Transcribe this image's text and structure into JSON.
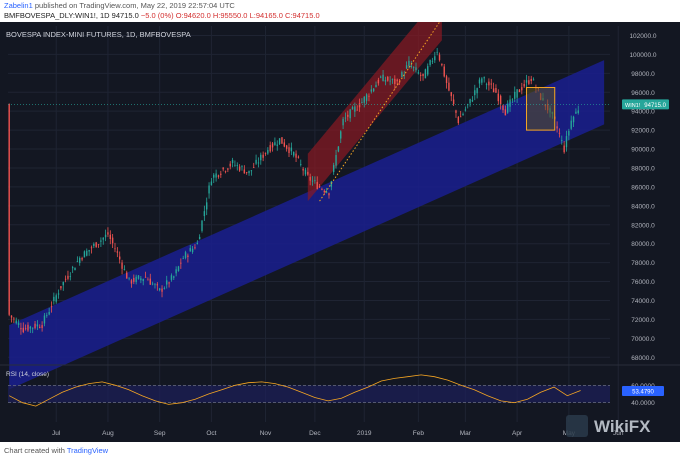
{
  "header": {
    "publisher_user": "Zabelin1",
    "publisher_text": " published on TradingView.com, May 22, 2019 22:57:04 UTC",
    "symbol_line_prefix": "BMFBOVESPA_DLY:WIN1!, 1D ",
    "last": "94715.0",
    "change": "−5.0 (0%)",
    "ohlc_o": "O:94620.0",
    "ohlc_h": "H:95550.0",
    "ohlc_l": "L:94165.0",
    "ohlc_c": "C:94715.0"
  },
  "footer": {
    "prefix": "Chart created with ",
    "brand": "TradingView"
  },
  "watermark": "WikiFX",
  "colors": {
    "background": "#131722",
    "grid": "#1f2433",
    "up_candle": "#26a69a",
    "down_candle": "#ef5350",
    "blue_channel": "#1a1f8f",
    "red_channel": "#8b1a22",
    "box_fill": "#5a5020",
    "box_stroke": "#f6a623",
    "rsi_line": "#f6a623",
    "price_tag": "#26a69a",
    "dotted_line": "#f6a623"
  },
  "chart_data": {
    "type": "candlestick",
    "title": "BOVESPA INDEX-MINI FUTURES, 1D, BMFBOVESPA",
    "price_axis_labels": [
      "102000.0",
      "100000.0",
      "98000.0",
      "96000.0",
      "94000.0",
      "92000.0",
      "90000.0",
      "88000.0",
      "86000.0",
      "84000.0",
      "82000.0",
      "80000.0",
      "78000.0",
      "76000.0",
      "74000.0",
      "72000.0",
      "70000.0",
      "68000.0"
    ],
    "ylim": [
      67500,
      103000
    ],
    "x_labels": [
      "Jul",
      "Aug",
      "Sep",
      "Oct",
      "Nov",
      "Dec",
      "2019",
      "Feb",
      "Mar",
      "Apr",
      "May",
      "Jun"
    ],
    "current_price_tag": {
      "symbol": "WIN1!",
      "value": "94715.0"
    },
    "close_path": [
      [
        0,
        72500
      ],
      [
        6,
        71000
      ],
      [
        14,
        71500
      ],
      [
        22,
        75500
      ],
      [
        30,
        78500
      ],
      [
        37,
        80000
      ],
      [
        42,
        81000
      ],
      [
        45,
        79500
      ],
      [
        51,
        76000
      ],
      [
        58,
        76500
      ],
      [
        64,
        75000
      ],
      [
        70,
        76500
      ],
      [
        74,
        78500
      ],
      [
        80,
        80000
      ],
      [
        86,
        87000
      ],
      [
        95,
        88500
      ],
      [
        102,
        87500
      ],
      [
        110,
        90000
      ],
      [
        115,
        91000
      ],
      [
        121,
        89500
      ],
      [
        127,
        87000
      ],
      [
        132,
        86000
      ],
      [
        136,
        85500
      ],
      [
        142,
        93000
      ],
      [
        150,
        95000
      ],
      [
        158,
        97500
      ],
      [
        165,
        97000
      ],
      [
        170,
        99000
      ],
      [
        176,
        97500
      ],
      [
        182,
        100500
      ],
      [
        186,
        97000
      ],
      [
        191,
        93000
      ],
      [
        196,
        95000
      ],
      [
        201,
        97500
      ],
      [
        207,
        96000
      ],
      [
        211,
        94000
      ],
      [
        216,
        96000
      ],
      [
        222,
        97500
      ],
      [
        226,
        95500
      ],
      [
        231,
        93500
      ],
      [
        234,
        91500
      ],
      [
        236,
        90000
      ],
      [
        239,
        93000
      ],
      [
        243,
        94715
      ]
    ],
    "rsi": {
      "label": "RSI (14, close)",
      "levels": [
        "60.0000",
        "40.0000"
      ],
      "current_value": "53.4790",
      "values": [
        48,
        40,
        36,
        44,
        52,
        58,
        62,
        64,
        60,
        55,
        48,
        42,
        38,
        40,
        44,
        50,
        55,
        60,
        63,
        64,
        62,
        58,
        52,
        46,
        42,
        45,
        52,
        58,
        65,
        68,
        70,
        72,
        70,
        66,
        60,
        55,
        48,
        42,
        40,
        44,
        52,
        58,
        48,
        54
      ]
    },
    "channels": [
      {
        "name": "blue-channel",
        "from": [
          0,
          68000
        ],
        "to": [
          253,
          96000
        ],
        "width_price": 3400
      },
      {
        "name": "red-channel",
        "from": [
          127,
          87000
        ],
        "to": [
          184,
          104000
        ],
        "width_price": 2500
      }
    ],
    "trendline": {
      "from": [
        132,
        84500
      ],
      "to": [
        190,
        106000
      ]
    },
    "box": {
      "x": [
        220,
        232
      ],
      "y": [
        92000,
        96500
      ]
    }
  }
}
